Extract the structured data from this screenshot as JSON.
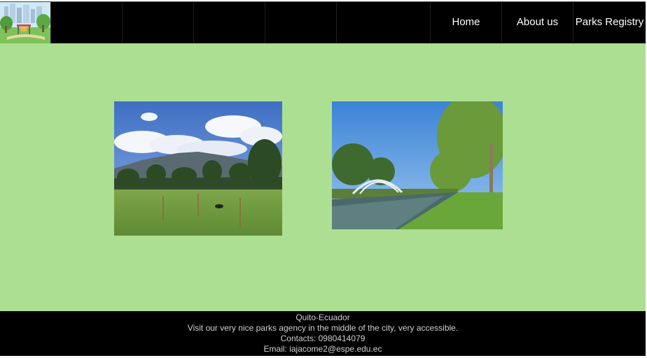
{
  "nav": {
    "links": [
      "Home",
      "About us",
      "Parks Registry"
    ]
  },
  "footer": {
    "city": "Quito-Ecuador",
    "tagline": "Visit our very nice parks agency in the middle of the city, very accessible.",
    "contacts": "Contacts: 0980414079",
    "email": "Email: iajacome2@espe.edu.ec"
  },
  "colors": {
    "main_bg": "#addf92",
    "nav_bg": "#000000"
  }
}
